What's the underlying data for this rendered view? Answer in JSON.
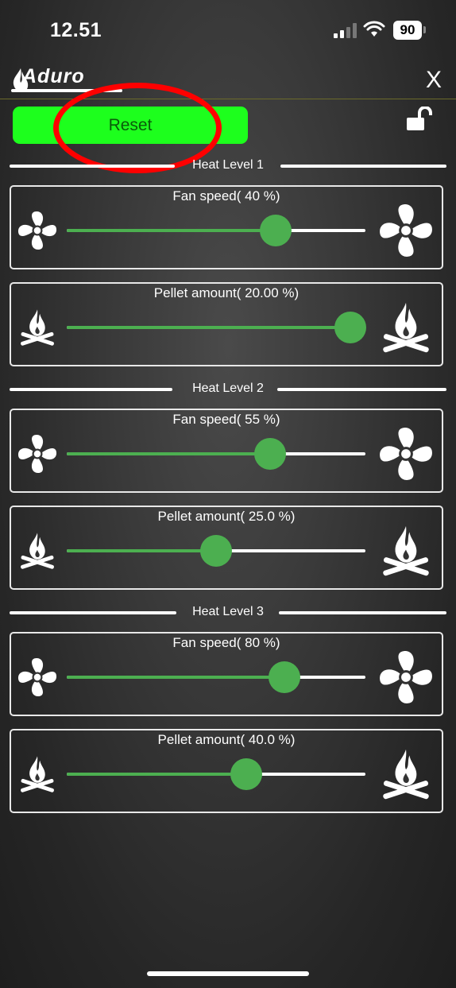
{
  "status_bar": {
    "time": "12.51",
    "battery": "90"
  },
  "header": {
    "logo_text": "Aduro",
    "close_label": "X"
  },
  "reset_button": {
    "label": "Reset"
  },
  "colors": {
    "accent_green": "#4caf50",
    "reset_green": "#1dff1d",
    "highlight_red": "#ff0000"
  },
  "icons": {
    "fan": "fan-icon",
    "fire": "campfire-icon",
    "lock": "unlocked-padlock-icon"
  },
  "heat_levels": [
    {
      "label": "Heat Level 1",
      "fan": {
        "title": "Fan speed( 40 %)",
        "value": 0.7
      },
      "pellet": {
        "title": "Pellet amount( 20.00 %)",
        "value": 0.95
      }
    },
    {
      "label": "Heat Level 2",
      "fan": {
        "title": "Fan speed( 55 %)",
        "value": 0.68
      },
      "pellet": {
        "title": "Pellet amount( 25.0 %)",
        "value": 0.5
      }
    },
    {
      "label": "Heat Level 3",
      "fan": {
        "title": "Fan speed( 80 %)",
        "value": 0.73
      },
      "pellet": {
        "title": "Pellet amount( 40.0 %)",
        "value": 0.6
      }
    }
  ]
}
